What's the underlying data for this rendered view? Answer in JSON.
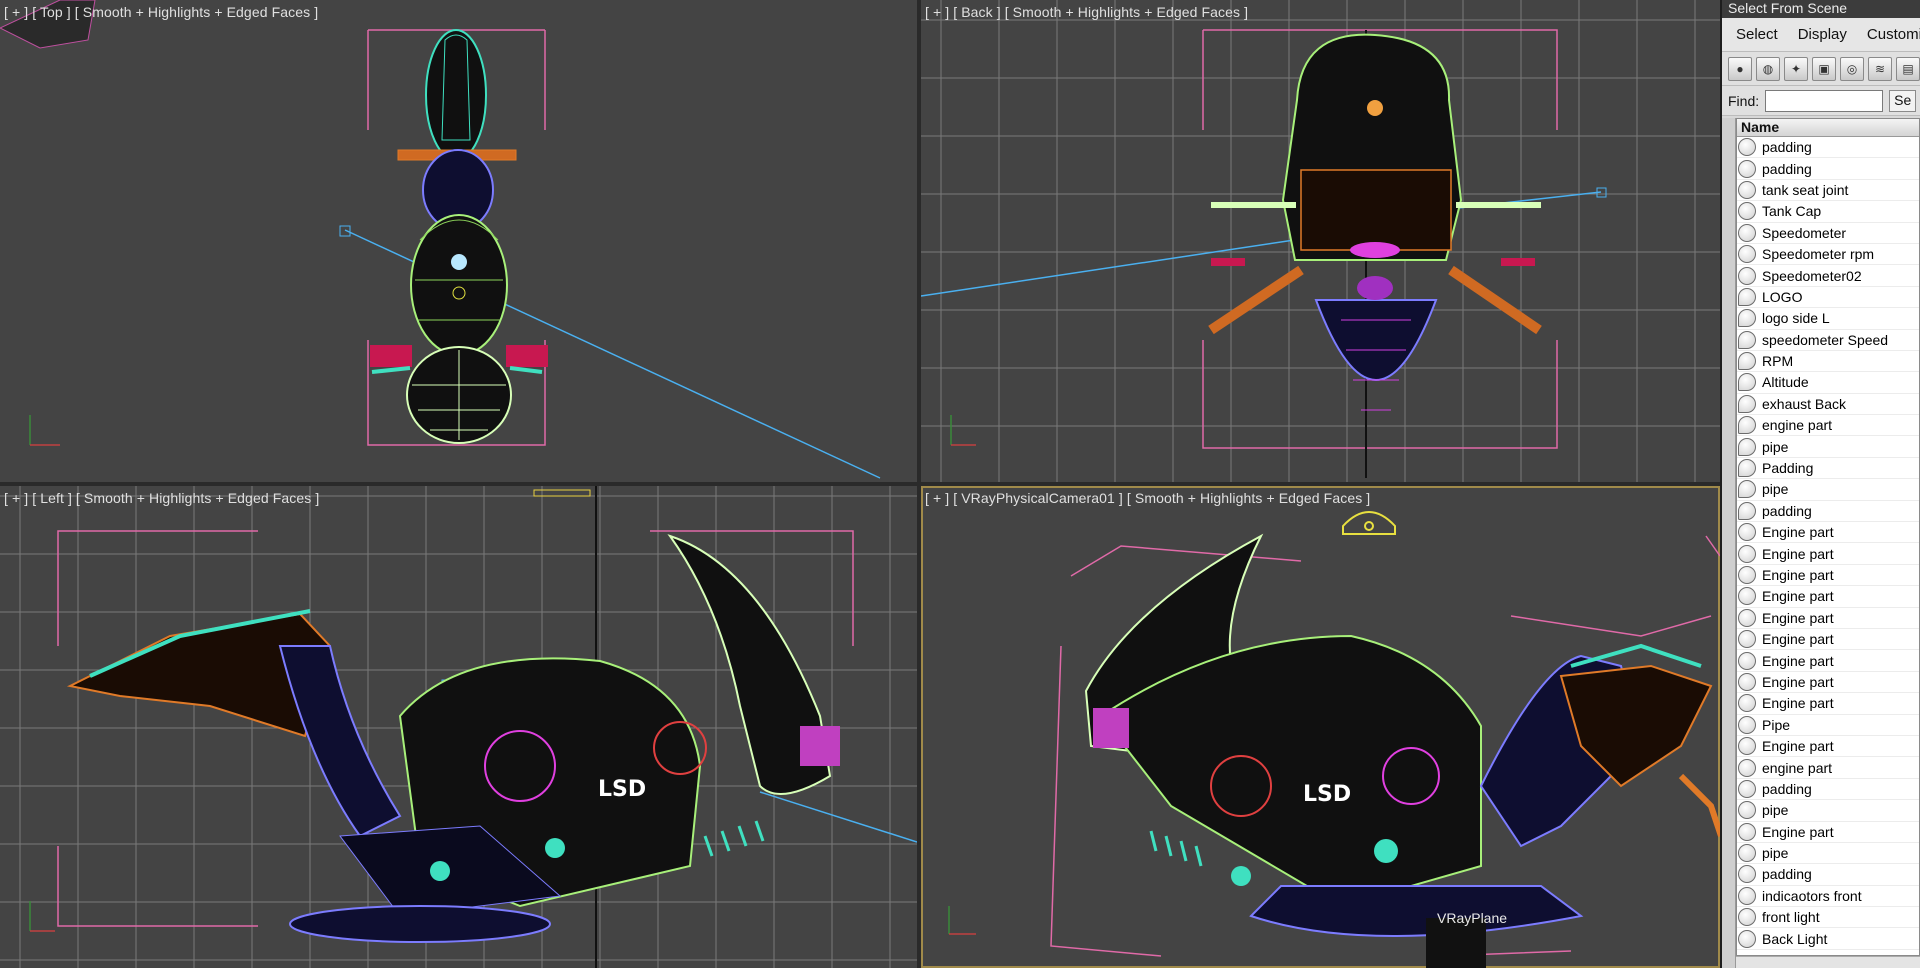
{
  "viewports": {
    "top": {
      "label": "[ + ] [ Top ] [ Smooth + Highlights + Edged Faces ]"
    },
    "back": {
      "label": "[ + ] [ Back ] [ Smooth + Highlights + Edged Faces ]"
    },
    "left": {
      "label": "[ + ] [ Left ] [ Smooth + Highlights + Edged Faces ]"
    },
    "camera": {
      "label": "[ + ] [ VRayPhysicalCamera01 ] [ Smooth + Highlights + Edged Faces ]",
      "object_label": "VRayPlane",
      "active": true
    }
  },
  "panel": {
    "title": "Select From Scene",
    "menus": [
      "Select",
      "Display",
      "Customize"
    ],
    "toolbar_icons": [
      "geometry-filter-icon",
      "shapes-filter-icon",
      "lights-filter-icon",
      "cameras-filter-icon",
      "helpers-filter-icon",
      "spacewarps-filter-icon",
      "groups-filter-icon"
    ],
    "find_label": "Find:",
    "find_value": "",
    "select_button": "Se",
    "column_header": "Name",
    "items": [
      "padding",
      "padding",
      "tank seat joint",
      "Tank Cap",
      "Speedometer",
      "Speedometer rpm",
      "Speedometer02",
      "LOGO",
      "logo side L",
      "speedometer Speed",
      "RPM",
      "Altitude",
      "exhaust Back",
      "engine part",
      "pipe",
      "Padding",
      "pipe",
      "padding",
      "Engine part",
      "Engine part",
      "Engine part",
      "Engine part",
      "Engine part",
      "Engine part",
      "Engine part",
      "Engine part",
      "Engine part",
      "Pipe",
      "Engine part",
      "engine part",
      "padding",
      "pipe",
      "Engine part",
      "pipe",
      "padding",
      "indicaotors front",
      "front light",
      "Back Light"
    ]
  },
  "colors": {
    "viewport_bg": "#444444",
    "grid": "#7a7a7a",
    "wire_green": "#a8f07a",
    "wire_teal": "#3fe0c0",
    "wire_orange": "#e07a28",
    "wire_blue": "#7c7cff",
    "wire_magenta": "#e040e0",
    "wire_pink": "#e06aa8",
    "camera_line": "#4ab0f0",
    "active_border": "#a08a4a"
  }
}
